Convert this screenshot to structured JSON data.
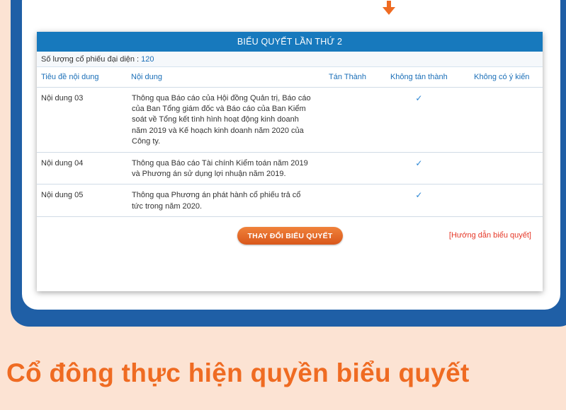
{
  "colors": {
    "background": "#fce3d3",
    "frame": "#1f5fa6",
    "header": "#1779bd",
    "accent_orange": "#ef6b22",
    "link_red": "#e53727",
    "check_blue": "#2a86d4"
  },
  "panel": {
    "title": "BIỂU QUYẾT LẦN THỨ 2",
    "shares_label": "Số lượng cổ phiếu đại diện : ",
    "shares_value": "120"
  },
  "table": {
    "headers": {
      "title": "Tiêu đề nội dung",
      "content": "Nội dung",
      "approve": "Tán Thành",
      "disapprove": "Không tán thành",
      "no_opinion": "Không có ý kiến"
    },
    "rows": [
      {
        "title": "Nội dung 03",
        "content": "Thông qua Báo cáo của Hội đồng Quản trị, Báo cáo của Ban Tổng giám đốc và Báo cáo của Ban Kiểm soát về Tổng kết tình hình hoạt động kinh doanh năm 2019 và Kế hoạch kinh doanh năm 2020 của Công ty.",
        "approve": "",
        "disapprove": "✓",
        "no_opinion": ""
      },
      {
        "title": "Nội dung 04",
        "content": "Thông qua Báo cáo Tài chính Kiểm toán năm 2019 và Phương án sử dụng lợi nhuận năm 2019.",
        "approve": "",
        "disapprove": "✓",
        "no_opinion": ""
      },
      {
        "title": "Nội dung 05",
        "content": "Thông qua Phương án phát hành cổ phiếu trả cổ tức trong năm 2020.",
        "approve": "",
        "disapprove": "✓",
        "no_opinion": ""
      }
    ]
  },
  "footer": {
    "change_button": "THAY ĐỔI BIỂU QUYẾT",
    "guide_link": "[Hướng dẫn biểu quyết]"
  },
  "caption": "Cổ đông thực hiện quyền biểu quyết"
}
